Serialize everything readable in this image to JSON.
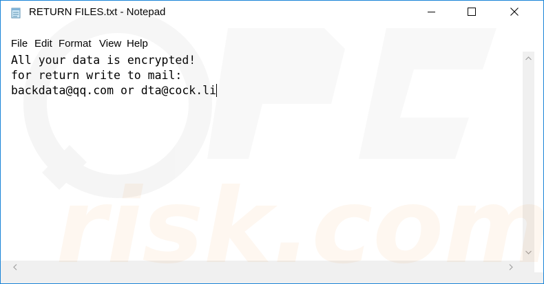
{
  "window": {
    "title": "RETURN FILES.txt - Notepad",
    "accent_color": "#1883d7"
  },
  "titlebar": {
    "app_icon": "notepad-icon",
    "minimize_icon": "minimize-icon",
    "maximize_icon": "maximize-icon",
    "close_icon": "close-icon"
  },
  "menu": {
    "items": [
      "File",
      "Edit",
      "Format",
      "View",
      "Help"
    ]
  },
  "editor": {
    "lines": [
      "All your data is encrypted!",
      "for return write to mail:",
      "backdata@qq.com or dta@cock.li"
    ]
  },
  "watermark": {
    "logo_text": "PC",
    "site_text": "risk.com"
  }
}
